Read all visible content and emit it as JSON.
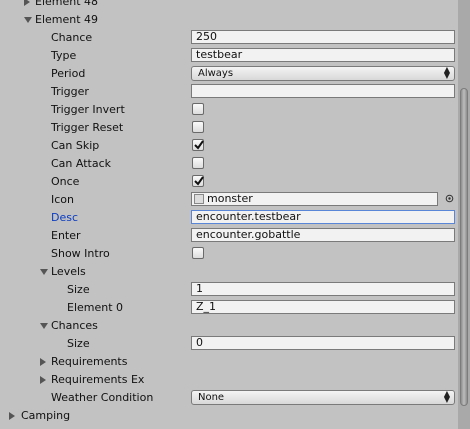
{
  "rows": {
    "element48": {
      "label": "Element 48"
    },
    "element49": {
      "label": "Element 49"
    },
    "chance": {
      "label": "Chance",
      "value": "250"
    },
    "type": {
      "label": "Type",
      "value": "testbear"
    },
    "period": {
      "label": "Period",
      "value": "Always"
    },
    "trigger": {
      "label": "Trigger",
      "value": ""
    },
    "trigger_invert": {
      "label": "Trigger Invert",
      "checked": false
    },
    "trigger_reset": {
      "label": "Trigger Reset",
      "checked": false
    },
    "can_skip": {
      "label": "Can Skip",
      "checked": true
    },
    "can_attack": {
      "label": "Can Attack",
      "checked": false
    },
    "once": {
      "label": "Once",
      "checked": true
    },
    "icon": {
      "label": "Icon",
      "value": "monster"
    },
    "desc": {
      "label": "Desc",
      "value": "encounter.testbear"
    },
    "enter": {
      "label": "Enter",
      "value": "encounter.gobattle"
    },
    "show_intro": {
      "label": "Show Intro",
      "checked": false
    },
    "levels": {
      "label": "Levels"
    },
    "levels_size": {
      "label": "Size",
      "value": "1"
    },
    "levels_element0": {
      "label": "Element 0",
      "value": "Z_1"
    },
    "chances": {
      "label": "Chances"
    },
    "chances_size": {
      "label": "Size",
      "value": "0"
    },
    "requirements": {
      "label": "Requirements"
    },
    "requirements_ex": {
      "label": "Requirements Ex"
    },
    "weather_condition": {
      "label": "Weather Condition",
      "value": "None"
    },
    "camping": {
      "label": "Camping"
    }
  },
  "colors": {
    "focus_label": "#0b3cc2",
    "background": "#c2c2c2"
  }
}
